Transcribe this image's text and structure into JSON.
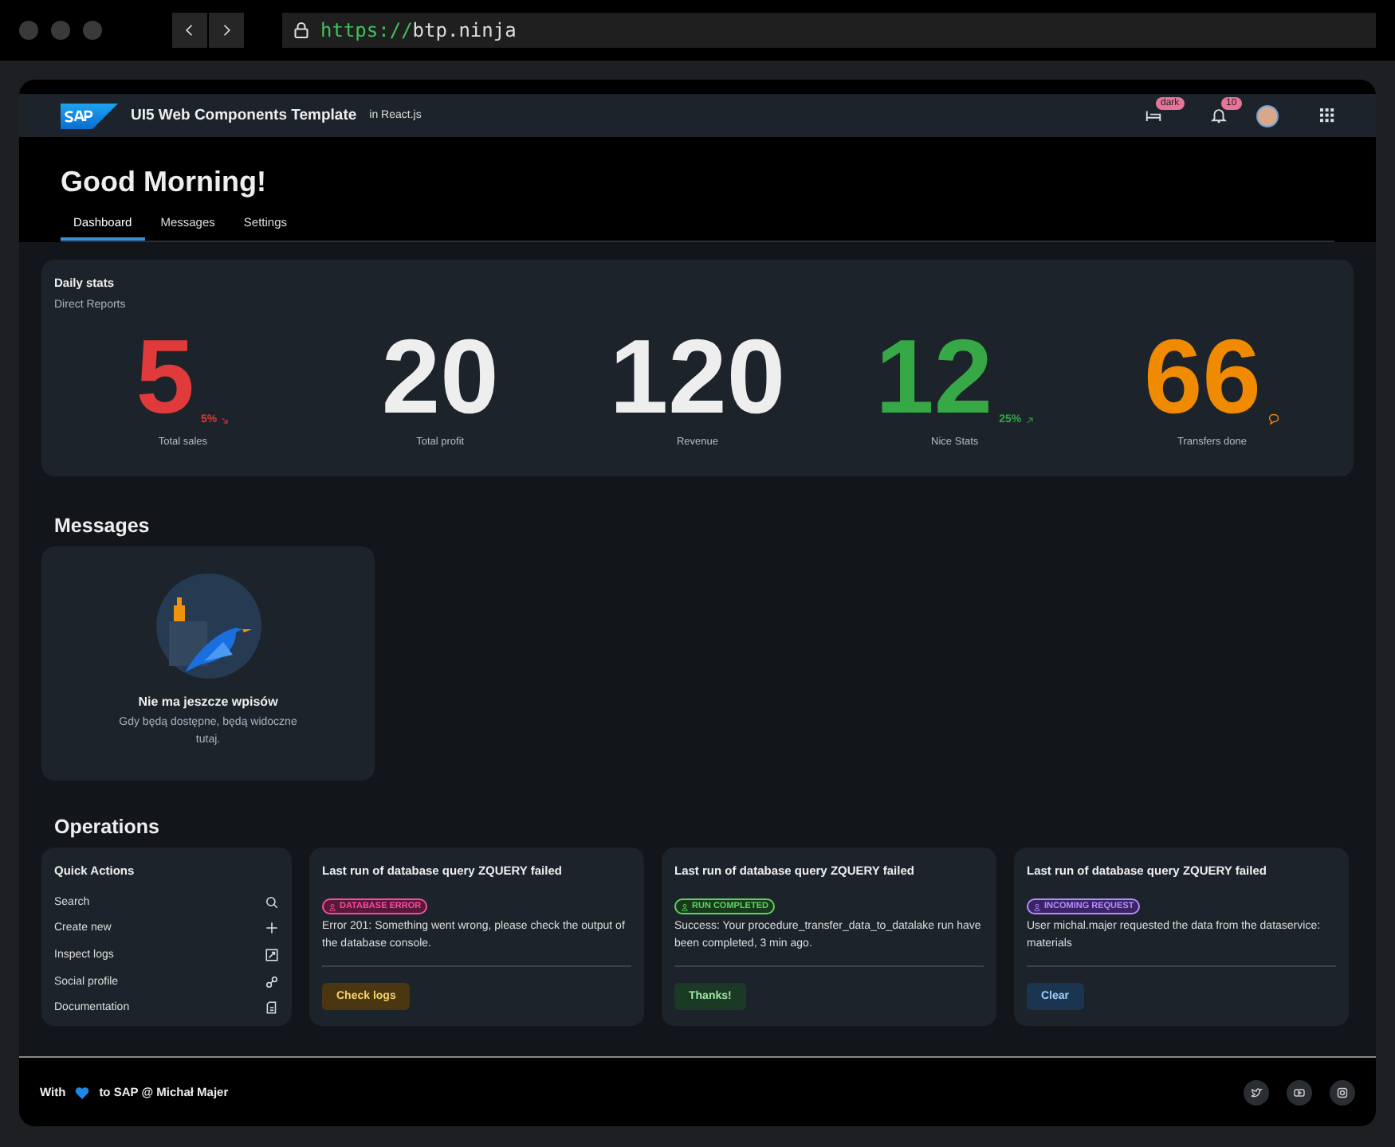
{
  "browser": {
    "url_scheme": "https://",
    "url_host": "btp.ninja"
  },
  "shell": {
    "title": "UI5 Web Components Template",
    "subtitle": "in React.js",
    "theme_badge": "dark",
    "notification_count": "10"
  },
  "header": {
    "title": "Good Morning!"
  },
  "tabs": [
    {
      "label": "Dashboard",
      "selected": true
    },
    {
      "label": "Messages",
      "selected": false
    },
    {
      "label": "Settings",
      "selected": false
    }
  ],
  "daily_stats": {
    "title": "Daily stats",
    "subtitle": "Direct Reports",
    "stats": [
      {
        "value": "5",
        "color": "#e03a3a",
        "trend": "5%",
        "kind": "down",
        "label": "Total sales"
      },
      {
        "value": "20",
        "color": "#eeeeee",
        "kind": "plain",
        "label": "Total profit"
      },
      {
        "value": "120",
        "color": "#eeeeee",
        "kind": "plain",
        "label": "Revenue"
      },
      {
        "value": "12",
        "color": "#36a846",
        "trend": "25%",
        "kind": "up",
        "label": "Nice Stats"
      },
      {
        "value": "66",
        "color": "#f08a00",
        "kind": "comment",
        "label": "Transfers done"
      }
    ]
  },
  "messages": {
    "heading": "Messages",
    "empty_title": "Nie ma jeszcze wpisów",
    "empty_text": "Gdy będą dostępne, będą widoczne tutaj."
  },
  "operations": {
    "heading": "Operations",
    "quick_actions": {
      "title": "Quick Actions",
      "items": [
        {
          "label": "Search",
          "kind": "search"
        },
        {
          "label": "Create new",
          "kind": "add"
        },
        {
          "label": "Inspect logs",
          "kind": "logs"
        },
        {
          "label": "Social profile",
          "kind": "social"
        },
        {
          "label": "Documentation",
          "kind": "doc"
        }
      ]
    },
    "cards": [
      {
        "title": "Last run of database query ZQUERY failed",
        "kind": "error",
        "badge": "DATABASE ERROR",
        "text": "Error 201: Something went wrong, please check the output of the database console.",
        "button": "Check logs"
      },
      {
        "title": "Last run of database query ZQUERY failed",
        "kind": "success",
        "badge": "RUN COMPLETED",
        "text": "Success: Your procedure_transfer_data_to_datalake run have been completed, 3 min ago.",
        "button": "Thanks!"
      },
      {
        "title": "Last run of database query ZQUERY failed",
        "kind": "info",
        "badge": "INCOMING REQUEST",
        "text": "User michal.majer requested the data from the dataservice: materials",
        "button": "Clear"
      }
    ]
  },
  "footer": {
    "text_before": "With",
    "text_after": "to SAP @ Michał Majer"
  }
}
